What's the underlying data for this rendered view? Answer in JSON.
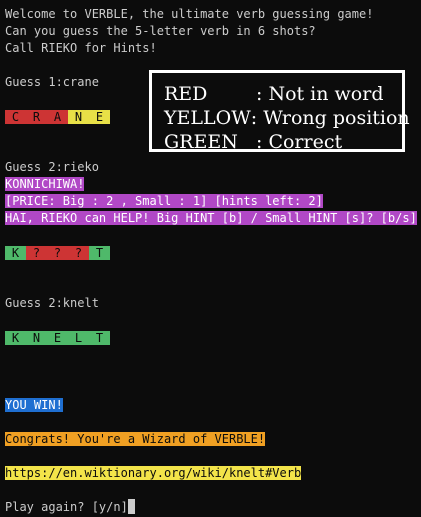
{
  "intro": [
    "Welcome to VERBLE, the ultimate verb guessing game!",
    "Can you guess the 5-letter verb in 6 shots?",
    "Call RIEKO for Hints!"
  ],
  "guess1": {
    "label": "Guess 1:crane",
    "tiles": [
      {
        "letter": "C",
        "color": "red"
      },
      {
        "letter": "R",
        "color": "red"
      },
      {
        "letter": "A",
        "color": "red"
      },
      {
        "letter": "N",
        "color": "yellow"
      },
      {
        "letter": "E",
        "color": "yellow"
      }
    ]
  },
  "guess2": {
    "label": "Guess 2:rieko",
    "hint_lines": [
      "KONNICHIWA!",
      "[PRICE: Big : 2 , Small : 1] [hints left: 2]",
      "HAI, RIEKO can HELP! Big HINT [b] / Small HINT [s]? [b/s]"
    ],
    "user_input": " b",
    "tiles": [
      {
        "letter": "K",
        "color": "green"
      },
      {
        "letter": "?",
        "color": "red"
      },
      {
        "letter": "?",
        "color": "red"
      },
      {
        "letter": "?",
        "color": "red"
      },
      {
        "letter": "T",
        "color": "green"
      }
    ]
  },
  "guess3": {
    "label": "Guess 2:knelt",
    "tiles": [
      {
        "letter": "K",
        "color": "green"
      },
      {
        "letter": "N",
        "color": "green"
      },
      {
        "letter": "E",
        "color": "green"
      },
      {
        "letter": "L",
        "color": "green"
      },
      {
        "letter": "T",
        "color": "green"
      }
    ]
  },
  "result": {
    "win": "YOU WIN!",
    "congrats": "Congrats! You're a Wizard of VERBLE!",
    "link": "https://en.wiktionary.org/wiki/knelt#Verb",
    "prompt": "Play again? [y/n]"
  },
  "legend": {
    "rows": [
      {
        "key": "RED",
        "value": ": Not in word"
      },
      {
        "key": "YELLOW",
        "value": ": Wrong position"
      },
      {
        "key": "GREEN",
        "value": ": Correct"
      }
    ]
  },
  "colors": {
    "background": "#0c0c0c",
    "text": "#cccccc",
    "tile_red": "#cd3434",
    "tile_yellow": "#e8e047",
    "tile_green": "#4fb96a",
    "highlight_pink": "#b148c6",
    "highlight_blue": "#1f6fd1",
    "highlight_orange": "#f0a023",
    "highlight_yellow": "#f3e44a"
  }
}
